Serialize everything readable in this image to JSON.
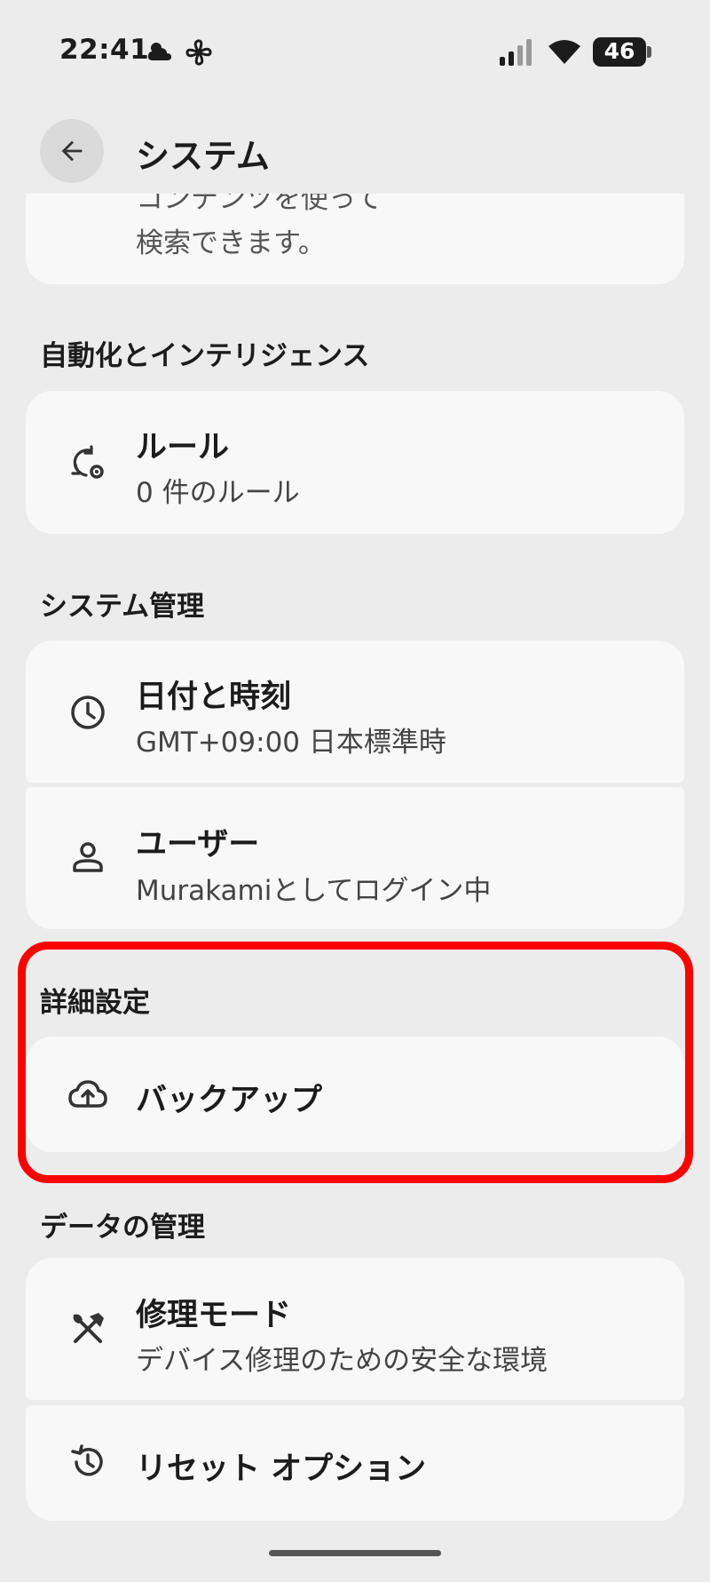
{
  "status_bar": {
    "time": "22:41",
    "battery": "46",
    "icons": [
      "weather-cloud-icon",
      "fan-icon",
      "signal-icon",
      "wifi-icon",
      "battery-icon"
    ]
  },
  "header": {
    "title": "システム",
    "back_icon": "arrow-back-icon"
  },
  "top_card": {
    "partial_line": "コンテンツを使って",
    "line": "検索できます。"
  },
  "sections": {
    "automation": {
      "header": "自動化とインテリジェンス",
      "items": [
        {
          "title": "ルール",
          "subtitle": "0 件のルール",
          "icon": "rules-sync-gear-icon"
        }
      ]
    },
    "system_management": {
      "header": "システム管理",
      "items": [
        {
          "title": "日付と時刻",
          "subtitle": "GMT+09:00 日本標準時",
          "icon": "clock-icon"
        },
        {
          "title": "ユーザー",
          "subtitle": "Murakamiとしてログイン中",
          "icon": "person-icon"
        }
      ]
    },
    "advanced": {
      "header": "詳細設定",
      "items": [
        {
          "title": "バックアップ",
          "icon": "cloud-upload-icon"
        }
      ]
    },
    "data_management": {
      "header": "データの管理",
      "items": [
        {
          "title": "修理モード",
          "subtitle": "デバイス修理のための安全な環境",
          "icon": "repair-tools-icon"
        },
        {
          "title": "リセット オプション",
          "icon": "history-reset-icon"
        }
      ]
    }
  },
  "colors": {
    "background": "#ececec",
    "card": "#f8f8f8",
    "highlight": "#ff0000"
  }
}
